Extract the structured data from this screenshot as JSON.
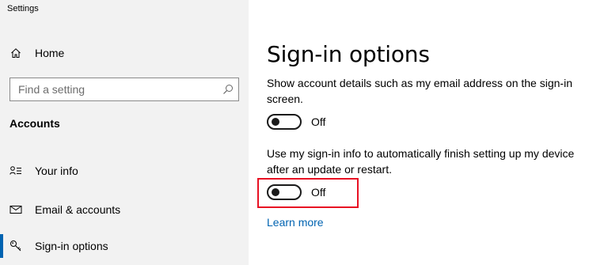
{
  "window": {
    "title": "Settings"
  },
  "sidebar": {
    "home_label": "Home",
    "search_placeholder": "Find a setting",
    "section_heading": "Accounts",
    "items": [
      {
        "label": "Your info",
        "icon": "person-list-icon"
      },
      {
        "label": "Email & accounts",
        "icon": "mail-icon"
      },
      {
        "label": "Sign-in options",
        "icon": "key-icon",
        "active": true
      }
    ]
  },
  "main": {
    "title": "Sign-in options",
    "settings": [
      {
        "description": "Show account details such as my email address on the sign-in screen.",
        "toggle_state": "Off"
      },
      {
        "description": "Use my sign-in info to automatically finish setting up my device after an update or restart.",
        "toggle_state": "Off",
        "highlighted": true
      }
    ],
    "learn_more": "Learn more"
  },
  "colors": {
    "accent": "#0063b1",
    "highlight": "#e81123",
    "sidebar_bg": "#f2f2f2"
  }
}
